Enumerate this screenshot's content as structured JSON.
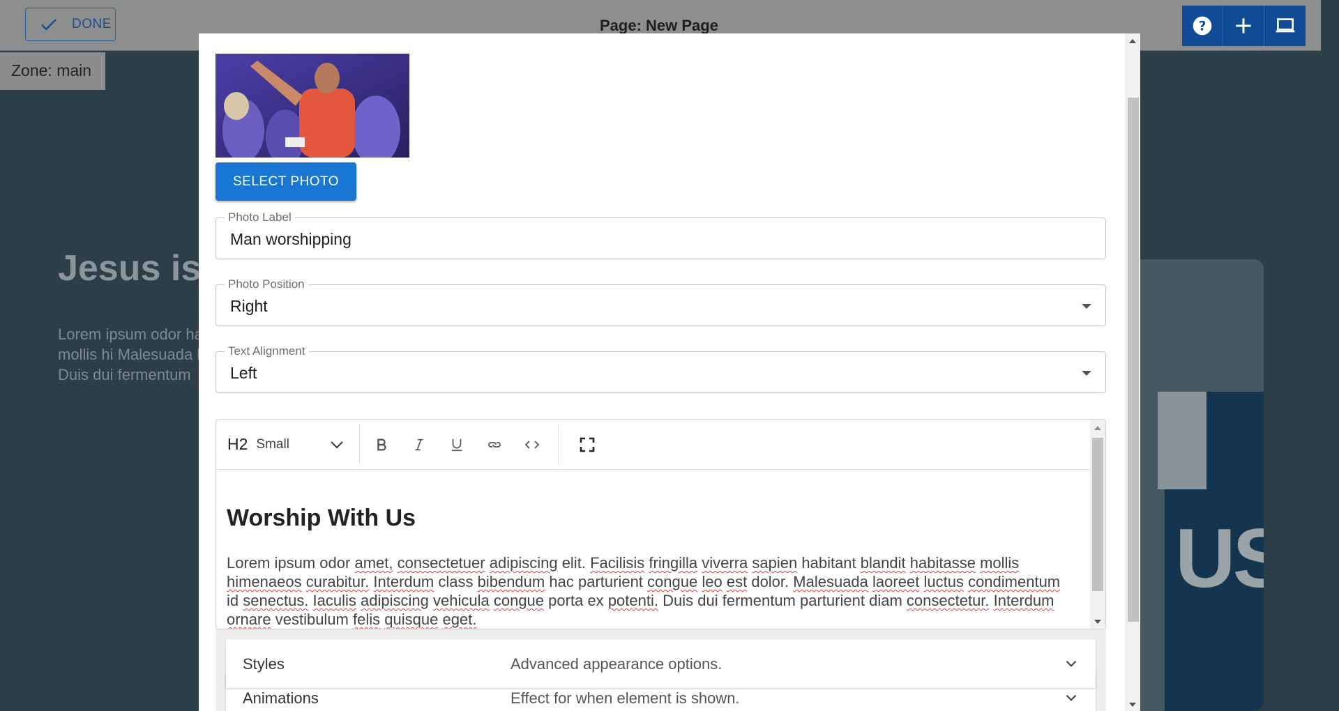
{
  "header": {
    "done_label": "DONE",
    "page_title": "Page: New Page",
    "tools": [
      "help-icon",
      "add-icon",
      "device-preview-icon"
    ]
  },
  "zone_label": "Zone: main",
  "background": {
    "heading": "Jesus is",
    "paragraph": "Lorem ipsum odor habitasse mollis hi Malesuada laoreet Duis dui fermentum",
    "card_text": "US"
  },
  "modal": {
    "select_photo_label": "SELECT PHOTO",
    "photo_label": {
      "legend": "Photo Label",
      "value": "Man worshipping"
    },
    "photo_position": {
      "legend": "Photo Position",
      "value": "Right"
    },
    "text_alignment": {
      "legend": "Text Alignment",
      "value": "Left"
    },
    "editor": {
      "block_type": "H2",
      "block_size": "Small",
      "heading": "Worship With Us",
      "paragraph": "Lorem ipsum odor amet, consectetuer adipiscing elit. Facilisis fringilla viverra sapien habitant blandit habitasse mollis himenaeos curabitur. Interdum class bibendum hac parturient congue leo est dolor. Malesuada laoreet luctus condimentum id senectus. Iaculis adipiscing vehicula congue porta ex potenti. Duis dui fermentum parturient diam consectetur. Interdum ornare vestibulum felis quisque eget."
    },
    "accordion": [
      {
        "title": "Styles",
        "description": "Advanced appearance options."
      },
      {
        "title": "Animations",
        "description": "Effect for when element is shown."
      }
    ]
  }
}
